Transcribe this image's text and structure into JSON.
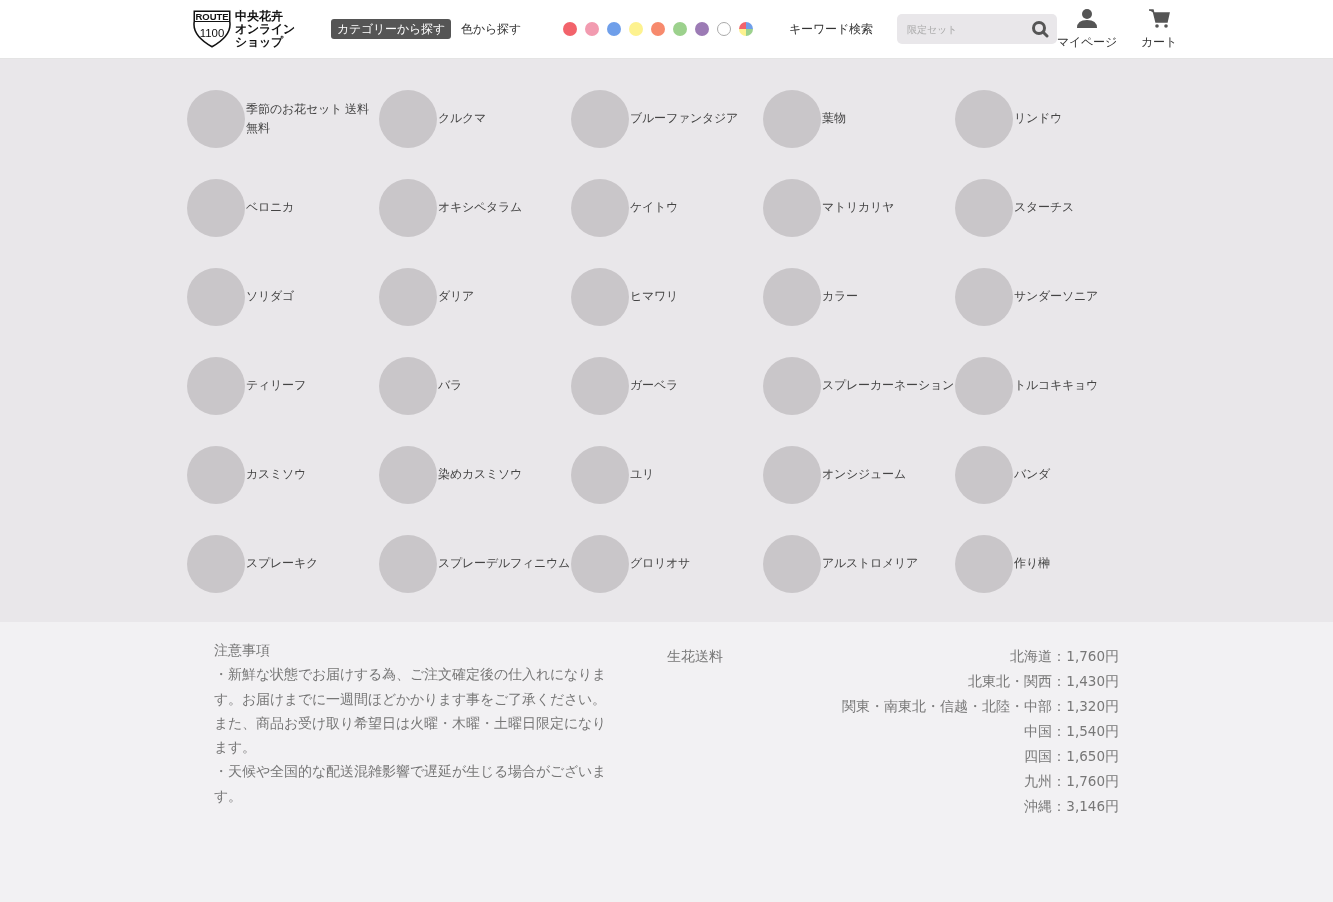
{
  "header": {
    "logo": {
      "badge_top": "ROUTE",
      "badge_number": "1100",
      "name_lines": [
        "中央花卉",
        "オンライン",
        "ショップ"
      ]
    },
    "search_tabs": [
      {
        "label": "カテゴリーから探す",
        "selected": true
      },
      {
        "label": "色から探す",
        "selected": false
      }
    ],
    "color_swatches": [
      {
        "kind": "solid",
        "color": "#f2636b"
      },
      {
        "kind": "solid",
        "color": "#f29bb0"
      },
      {
        "kind": "solid",
        "color": "#6f9fea"
      },
      {
        "kind": "solid",
        "color": "#fdf28f"
      },
      {
        "kind": "solid",
        "color": "#f78a6d"
      },
      {
        "kind": "solid",
        "color": "#9cd18d"
      },
      {
        "kind": "solid",
        "color": "#9c7bb5"
      },
      {
        "kind": "solid",
        "color": "#ffffff"
      },
      {
        "kind": "multi"
      }
    ],
    "keyword_label": "キーワード検索",
    "search": {
      "placeholder": "限定セット"
    },
    "actions": [
      {
        "kind": "user",
        "label": "マイページ"
      },
      {
        "kind": "cart",
        "label": "カート"
      }
    ]
  },
  "categories": [
    {
      "label": "季節のお花セット 送料無料"
    },
    {
      "label": "クルクマ"
    },
    {
      "label": "ブルーファンタジア"
    },
    {
      "label": "葉物"
    },
    {
      "label": "リンドウ"
    },
    {
      "label": "ベロニカ"
    },
    {
      "label": "オキシペタラム"
    },
    {
      "label": "ケイトウ"
    },
    {
      "label": "マトリカリヤ"
    },
    {
      "label": "スターチス"
    },
    {
      "label": "ソリダゴ"
    },
    {
      "label": "ダリア"
    },
    {
      "label": "ヒマワリ"
    },
    {
      "label": "カラー"
    },
    {
      "label": "サンダーソニア"
    },
    {
      "label": "ティリーフ"
    },
    {
      "label": "バラ"
    },
    {
      "label": "ガーベラ"
    },
    {
      "label": "スプレーカーネーション"
    },
    {
      "label": "トルコキキョウ"
    },
    {
      "label": "カスミソウ"
    },
    {
      "label": "染めカスミソウ"
    },
    {
      "label": "ユリ"
    },
    {
      "label": "オンシジューム"
    },
    {
      "label": "バンダ"
    },
    {
      "label": "スプレーキク"
    },
    {
      "label": "スプレーデルフィニウム"
    },
    {
      "label": "グロリオサ"
    },
    {
      "label": "アルストロメリア"
    },
    {
      "label": "作り榊"
    }
  ],
  "notes": {
    "title": "注意事項",
    "lines": [
      "・新鮮な状態でお届けする為、ご注文確定後の仕入れになります。お届けまでに一週間ほどかかります事をご了承ください。また、商品お受け取り希望日は火曜・木曜・土曜日限定になります。",
      "・天候や全国的な配送混雑影響で遅延が生じる場合がございます。"
    ]
  },
  "shipping": {
    "title": "生花送料",
    "rates": [
      "北海道：1,760円",
      "北東北・関西：1,430円",
      "関東・南東北・信越・北陸・中部：1,320円",
      "中国：1,540円",
      "四国：1,650円",
      "九州：1,760円",
      "沖縄：3,146円"
    ]
  }
}
